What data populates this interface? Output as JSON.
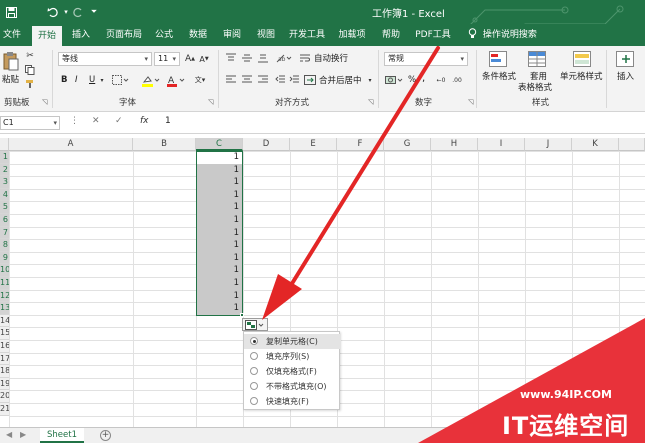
{
  "window": {
    "title": "工作簿1 - Excel"
  },
  "tabs": [
    {
      "label": "文件"
    },
    {
      "label": "开始"
    },
    {
      "label": "插入"
    },
    {
      "label": "页面布局"
    },
    {
      "label": "公式"
    },
    {
      "label": "数据"
    },
    {
      "label": "审阅"
    },
    {
      "label": "视图"
    },
    {
      "label": "开发工具"
    },
    {
      "label": "加载项"
    },
    {
      "label": "帮助"
    },
    {
      "label": "PDF工具"
    }
  ],
  "active_tab": "开始",
  "tell_me": "操作说明搜索",
  "ribbon": {
    "clipboard": {
      "paste_label": "粘贴",
      "group_label": "剪贴板"
    },
    "font": {
      "name": "等线",
      "size": "11",
      "bold": "B",
      "italic": "I",
      "underline": "U",
      "group_label": "字体"
    },
    "alignment": {
      "wrap_text": "自动换行",
      "merge_center": "合并后居中",
      "group_label": "对齐方式"
    },
    "number": {
      "format": "常规",
      "group_label": "数字"
    },
    "styles": {
      "conditional": "条件格式",
      "table_line1": "套用",
      "table_line2": "表格格式",
      "cell_styles": "单元格样式",
      "group_label": "样式"
    },
    "cells": {
      "insert": "插入"
    }
  },
  "formula_bar": {
    "name_box": "C1",
    "fx": "fx",
    "value": "1"
  },
  "columns": [
    "A",
    "B",
    "C",
    "D",
    "E",
    "F",
    "G",
    "H",
    "I",
    "J",
    "K"
  ],
  "selected_column": "C",
  "rows": [
    "1",
    "2",
    "3",
    "4",
    "5",
    "6",
    "7",
    "8",
    "9",
    "10",
    "11",
    "12",
    "13",
    "14",
    "15",
    "16",
    "17",
    "18",
    "19",
    "20",
    "21"
  ],
  "cells_c": [
    "1",
    "1",
    "1",
    "1",
    "1",
    "1",
    "1",
    "1",
    "1",
    "1",
    "1",
    "1",
    "1"
  ],
  "autofill_menu": {
    "items": [
      {
        "label": "复制单元格(C)",
        "checked": true
      },
      {
        "label": "填充序列(S)",
        "checked": false
      },
      {
        "label": "仅填充格式(F)",
        "checked": false
      },
      {
        "label": "不带格式填充(O)",
        "checked": false
      },
      {
        "label": "快速填充(F)",
        "checked": false
      }
    ]
  },
  "sheet_tabs": [
    {
      "label": "Sheet1"
    }
  ],
  "watermark": {
    "url": "www.94IP.COM",
    "name": "IT运维空间"
  },
  "colors": {
    "excel_green": "#217346",
    "arrow_red": "#e32626",
    "selection_gray": "#c9c9c9"
  },
  "icons": [
    "save-icon",
    "undo-icon",
    "redo-icon",
    "customize-qat-icon",
    "lightbulb-icon",
    "cut-icon",
    "copy-icon",
    "format-painter-icon",
    "fill-color-icon",
    "font-color-icon",
    "align-icon",
    "orientation-icon",
    "indent-icon",
    "wrap-text-icon",
    "merge-icon",
    "currency-icon",
    "percent-icon",
    "comma-icon",
    "decimal-icon",
    "launcher-icon",
    "autofill-options-icon",
    "add-sheet-icon",
    "red-arrow"
  ]
}
